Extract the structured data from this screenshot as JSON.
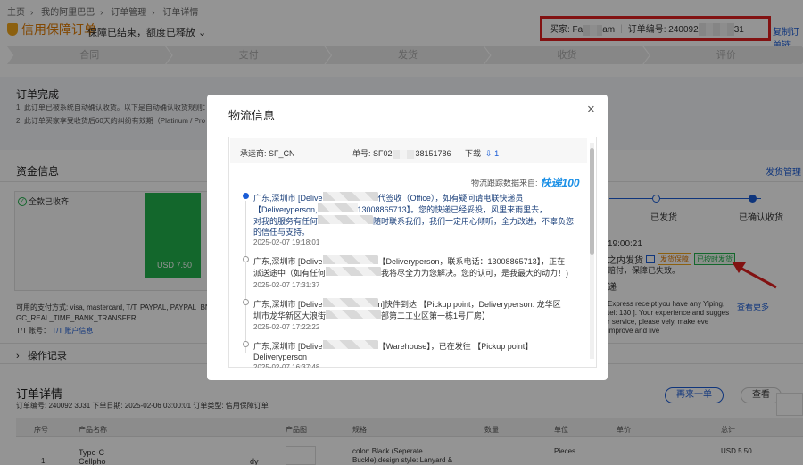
{
  "breadcrumb": [
    "主页",
    "我的阿里巴巴",
    "订单管理",
    "订单详情"
  ],
  "header": {
    "title": "信用保障订单",
    "subtitle": "保障已结束，额度已释放",
    "buyer_label": "买家: Fa",
    "buyer_suffix": "am",
    "order_no_label": "订单编号: 240092",
    "order_no_suffix": "31",
    "copy_link": "复制订单链"
  },
  "steps": [
    "合同",
    "支付",
    "发货",
    "收货",
    "评价"
  ],
  "complete": {
    "title": "订单完成",
    "line1": "1. 此订单已被系统自动确认收货。以下是自动确认收货规则：如果未",
    "line2": "2. 此订单买家享受收货后60天的纠纷有效期（Platinum / Pro Buye"
  },
  "funds": {
    "title": "资金信息",
    "ship_manage": "发货管理",
    "full_received": "全款已收齐",
    "bar_label": "USD 7.50",
    "pay_methods": "可用的支付方式: visa, mastercard, T/T, PAYPAL, PAYPAL_BNPL, A",
    "pay_methods2": "GC_REAL_TIME_BANK_TRANSFER",
    "tt_label": "T/T 账号：",
    "tt_link": "T/T 账户信息"
  },
  "progress": {
    "shipped": "已发货",
    "confirmed": "已确认收货",
    "time": "19:00:21",
    "ship_in": "之内发货",
    "tag_ship_guarantee": "发货保障",
    "tag_on_time": "已按时发货",
    "ship_note": "赔付，保障已失效。",
    "tip": "递",
    "express_text": "Express receipt you have any Yiping, tel: 130 ]. Your experience and sugges r service, please vely, make eve improve and live",
    "see_more": "查看更多"
  },
  "operation_record": "操作记录",
  "order_detail": {
    "title": "订单详情",
    "meta": "订单编号: 240092        3031    下单日期: 2025-02-06 03:00:01    订单类型: 信用保障订单",
    "reorder": "再来一单",
    "view": "查看",
    "columns": [
      "序号",
      "产品名称",
      "产品图",
      "规格",
      "数量",
      "单位",
      "单价",
      "总计"
    ],
    "row": {
      "index": "1",
      "name": "Type-C",
      "name2": "Cellpho",
      "name_suffix": "dy",
      "spec": "color: Black (Seperate Buckle),design style: Lanyard &",
      "unit": "Pieces",
      "total": "USD 5.50"
    }
  },
  "modal": {
    "title": "物流信息",
    "close": "×",
    "carrier": "承运商: SF_CN",
    "waybill_prefix": "单号: SF02",
    "waybill_suffix": "38151786",
    "download": "下载",
    "download_count": "1",
    "source_label": "物流跟踪数据来自:",
    "source_logo": "快递100",
    "events": [
      {
        "text1": "广东,深圳市 [Delive",
        "text1b": "代签收（Office），如有疑问请电联快递员",
        "text2": "【Deliveryperson,",
        "text2b": "13008865713】。您的快递已经妥投，风里来雨里去，",
        "text3": "对我的服务有任何",
        "text3b": "随时联系我们，我们一定用心倾听，全力改进，不辜负您",
        "text4": "的信任与支持。",
        "time": "2025-02-07 19:18:01",
        "active": true
      },
      {
        "text1": "广东,深圳市 [Delive",
        "text1b": "【Deliveryperson，联系电话：13008865713】，正在",
        "text2": "派送途中（如有任何",
        "text2b": "我将尽全力为您解决。您的认可，是我最大的动力！)",
        "time": "2025-02-07 17:31:37",
        "active": false
      },
      {
        "text1": "广东,深圳市 [Delive",
        "text1b": "n]快件到达 【Pickup point，Deliveryperson: 龙华区",
        "text2": "圳市龙华新区大浪街",
        "text2b": "部第二工业区第一栋1号厂房】",
        "time": "2025-02-07 17:22:22",
        "active": false
      },
      {
        "text1": "广东,深圳市 [Delive",
        "text1b": "【Warehouse】，已在发往 【Pickup point】",
        "text2": "Deliveryperson",
        "time": "2025-02-07 16:37:48",
        "active": false
      }
    ]
  },
  "colors": {
    "accent": "#1a5cd6",
    "orange": "#e07a00",
    "green": "#22b14c",
    "red_frame": "#e02020"
  }
}
